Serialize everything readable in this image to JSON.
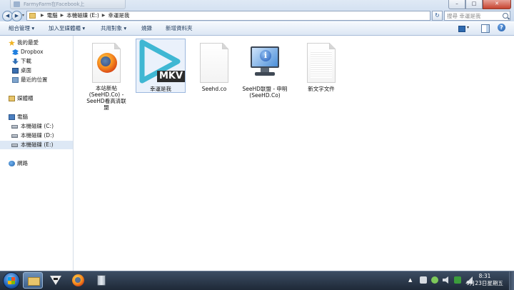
{
  "window": {
    "background_tab_title": "FarmyFarm在Facebook上",
    "controls": {
      "minimize": "–",
      "maximize": "□",
      "close": "✕"
    }
  },
  "address": {
    "crumbs": [
      "電腦",
      "本機磁碟 (E:)",
      "幸運是我"
    ],
    "search_placeholder": "搜尋 幸運是我"
  },
  "toolbar": {
    "organize": "組合管理 ▾",
    "add_to_library": "加入至媒體櫃 ▾",
    "share_with": "共用對象 ▾",
    "burn": "燒錄",
    "new_folder": "新增資料夾"
  },
  "sidebar": {
    "favorites": "我的最愛",
    "dropbox": "Dropbox",
    "downloads": "下載",
    "desktop": "桌面",
    "recent": "最近的位置",
    "libraries": "媒體櫃",
    "computer": "電腦",
    "drive_c": "本機磁碟 (C:)",
    "drive_d": "本機磁碟 (D:)",
    "drive_e": "本機磁碟 (E:)",
    "network": "網路"
  },
  "files": [
    {
      "name_lines": [
        "本站新帖",
        "(SeeHD.Co) -",
        "SeeHD看高清联",
        "盟"
      ],
      "icon": "firefox-html-icon"
    },
    {
      "name": "幸運是我",
      "badge": "MKV",
      "icon": "mkv-video-icon",
      "selected": true
    },
    {
      "name": "Seehd.co",
      "icon": "blank-document-icon"
    },
    {
      "name_lines": [
        "SeeHD联盟 - 申明",
        "(SeeHD.Co)"
      ],
      "icon": "internet-shortcut-icon"
    },
    {
      "name": "新文字文件",
      "icon": "text-document-icon"
    }
  ],
  "clock": {
    "time": "8:31",
    "date": "9月23日星期五"
  }
}
